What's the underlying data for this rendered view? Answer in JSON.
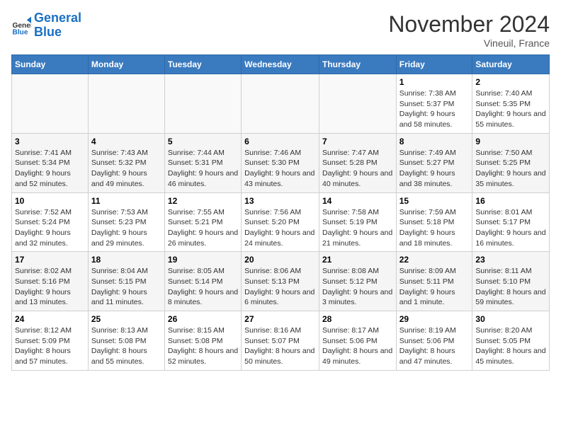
{
  "logo": {
    "line1": "General",
    "line2": "Blue"
  },
  "title": "November 2024",
  "location": "Vineuil, France",
  "headers": [
    "Sunday",
    "Monday",
    "Tuesday",
    "Wednesday",
    "Thursday",
    "Friday",
    "Saturday"
  ],
  "weeks": [
    [
      {
        "day": "",
        "info": ""
      },
      {
        "day": "",
        "info": ""
      },
      {
        "day": "",
        "info": ""
      },
      {
        "day": "",
        "info": ""
      },
      {
        "day": "",
        "info": ""
      },
      {
        "day": "1",
        "info": "Sunrise: 7:38 AM\nSunset: 5:37 PM\nDaylight: 9 hours and 58 minutes."
      },
      {
        "day": "2",
        "info": "Sunrise: 7:40 AM\nSunset: 5:35 PM\nDaylight: 9 hours and 55 minutes."
      }
    ],
    [
      {
        "day": "3",
        "info": "Sunrise: 7:41 AM\nSunset: 5:34 PM\nDaylight: 9 hours and 52 minutes."
      },
      {
        "day": "4",
        "info": "Sunrise: 7:43 AM\nSunset: 5:32 PM\nDaylight: 9 hours and 49 minutes."
      },
      {
        "day": "5",
        "info": "Sunrise: 7:44 AM\nSunset: 5:31 PM\nDaylight: 9 hours and 46 minutes."
      },
      {
        "day": "6",
        "info": "Sunrise: 7:46 AM\nSunset: 5:30 PM\nDaylight: 9 hours and 43 minutes."
      },
      {
        "day": "7",
        "info": "Sunrise: 7:47 AM\nSunset: 5:28 PM\nDaylight: 9 hours and 40 minutes."
      },
      {
        "day": "8",
        "info": "Sunrise: 7:49 AM\nSunset: 5:27 PM\nDaylight: 9 hours and 38 minutes."
      },
      {
        "day": "9",
        "info": "Sunrise: 7:50 AM\nSunset: 5:25 PM\nDaylight: 9 hours and 35 minutes."
      }
    ],
    [
      {
        "day": "10",
        "info": "Sunrise: 7:52 AM\nSunset: 5:24 PM\nDaylight: 9 hours and 32 minutes."
      },
      {
        "day": "11",
        "info": "Sunrise: 7:53 AM\nSunset: 5:23 PM\nDaylight: 9 hours and 29 minutes."
      },
      {
        "day": "12",
        "info": "Sunrise: 7:55 AM\nSunset: 5:21 PM\nDaylight: 9 hours and 26 minutes."
      },
      {
        "day": "13",
        "info": "Sunrise: 7:56 AM\nSunset: 5:20 PM\nDaylight: 9 hours and 24 minutes."
      },
      {
        "day": "14",
        "info": "Sunrise: 7:58 AM\nSunset: 5:19 PM\nDaylight: 9 hours and 21 minutes."
      },
      {
        "day": "15",
        "info": "Sunrise: 7:59 AM\nSunset: 5:18 PM\nDaylight: 9 hours and 18 minutes."
      },
      {
        "day": "16",
        "info": "Sunrise: 8:01 AM\nSunset: 5:17 PM\nDaylight: 9 hours and 16 minutes."
      }
    ],
    [
      {
        "day": "17",
        "info": "Sunrise: 8:02 AM\nSunset: 5:16 PM\nDaylight: 9 hours and 13 minutes."
      },
      {
        "day": "18",
        "info": "Sunrise: 8:04 AM\nSunset: 5:15 PM\nDaylight: 9 hours and 11 minutes."
      },
      {
        "day": "19",
        "info": "Sunrise: 8:05 AM\nSunset: 5:14 PM\nDaylight: 9 hours and 8 minutes."
      },
      {
        "day": "20",
        "info": "Sunrise: 8:06 AM\nSunset: 5:13 PM\nDaylight: 9 hours and 6 minutes."
      },
      {
        "day": "21",
        "info": "Sunrise: 8:08 AM\nSunset: 5:12 PM\nDaylight: 9 hours and 3 minutes."
      },
      {
        "day": "22",
        "info": "Sunrise: 8:09 AM\nSunset: 5:11 PM\nDaylight: 9 hours and 1 minute."
      },
      {
        "day": "23",
        "info": "Sunrise: 8:11 AM\nSunset: 5:10 PM\nDaylight: 8 hours and 59 minutes."
      }
    ],
    [
      {
        "day": "24",
        "info": "Sunrise: 8:12 AM\nSunset: 5:09 PM\nDaylight: 8 hours and 57 minutes."
      },
      {
        "day": "25",
        "info": "Sunrise: 8:13 AM\nSunset: 5:08 PM\nDaylight: 8 hours and 55 minutes."
      },
      {
        "day": "26",
        "info": "Sunrise: 8:15 AM\nSunset: 5:08 PM\nDaylight: 8 hours and 52 minutes."
      },
      {
        "day": "27",
        "info": "Sunrise: 8:16 AM\nSunset: 5:07 PM\nDaylight: 8 hours and 50 minutes."
      },
      {
        "day": "28",
        "info": "Sunrise: 8:17 AM\nSunset: 5:06 PM\nDaylight: 8 hours and 49 minutes."
      },
      {
        "day": "29",
        "info": "Sunrise: 8:19 AM\nSunset: 5:06 PM\nDaylight: 8 hours and 47 minutes."
      },
      {
        "day": "30",
        "info": "Sunrise: 8:20 AM\nSunset: 5:05 PM\nDaylight: 8 hours and 45 minutes."
      }
    ]
  ]
}
